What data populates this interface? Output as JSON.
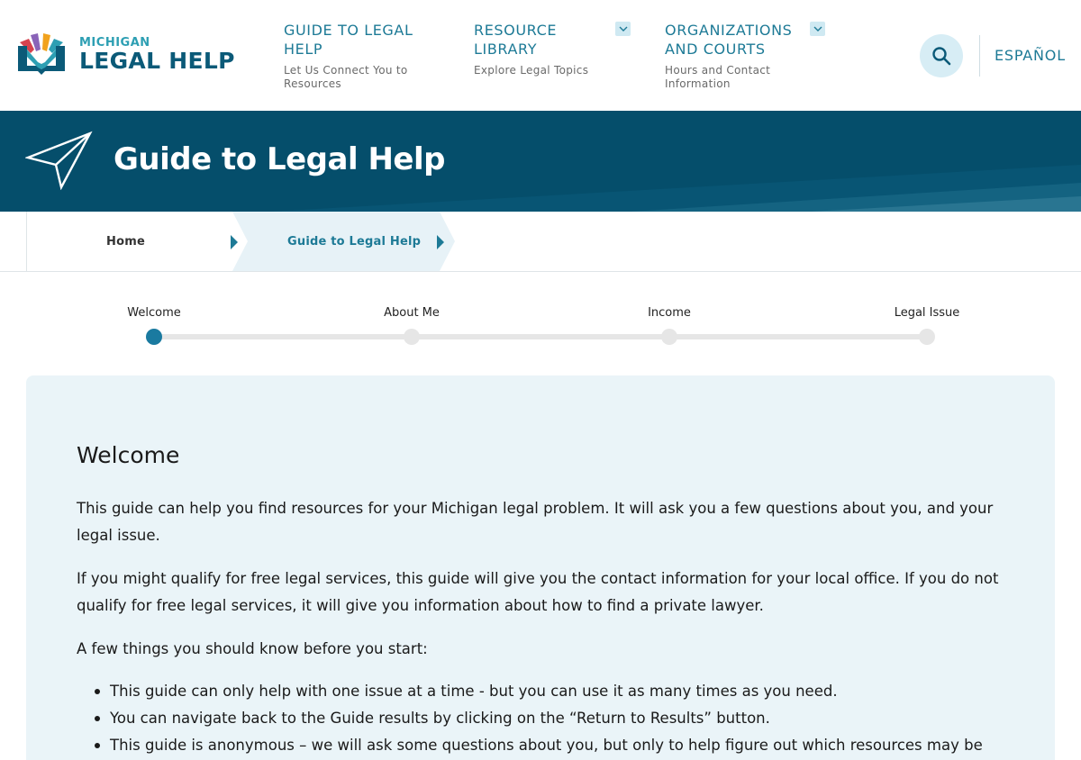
{
  "brand": {
    "small": "MICHIGAN",
    "big": "LEGAL HELP"
  },
  "nav": {
    "items": [
      {
        "title": "GUIDE TO LEGAL HELP",
        "subtitle": "Let Us Connect You to Resources"
      },
      {
        "title": "RESOURCE LIBRARY",
        "subtitle": "Explore Legal Topics"
      },
      {
        "title": "ORGANIZATIONS AND COURTS",
        "subtitle": "Hours and Contact Information"
      }
    ],
    "language": "ESPAÑOL"
  },
  "banner": {
    "title": "Guide to Legal Help"
  },
  "breadcrumb": {
    "home": "Home",
    "current": "Guide to Legal Help"
  },
  "steps": {
    "items": [
      "Welcome",
      "About Me",
      "Income",
      "Legal Issue"
    ],
    "active_index": 0
  },
  "card": {
    "title": "Welcome",
    "paragraphs": [
      "This guide can help you find resources for your Michigan legal problem. It will ask you a few questions about you, and your legal issue.",
      "If you might qualify for free legal services, this guide will give you the contact information for your local office. If you do not qualify for free legal services, it will give you information about how to find a private lawyer.",
      "A few things you should know before you start:"
    ],
    "bullets": [
      "This guide can only help with one issue at a time - but you can use it as many times as you need.",
      "You can navigate back to the Guide results by clicking on the “Return to Results” button.",
      "This guide is anonymous – we will ask some questions about you, but only to help figure out which resources may be"
    ]
  },
  "colors": {
    "brand_dark": "#0b5a78",
    "brand_teal": "#1d7a96",
    "banner_bg": "#054e6b",
    "card_bg": "#eaf4f8",
    "step_active": "#1a7aa0"
  },
  "icons": {
    "search": "search-icon",
    "chevron": "chevron-down-icon",
    "banner": "paper-plane-icon"
  }
}
